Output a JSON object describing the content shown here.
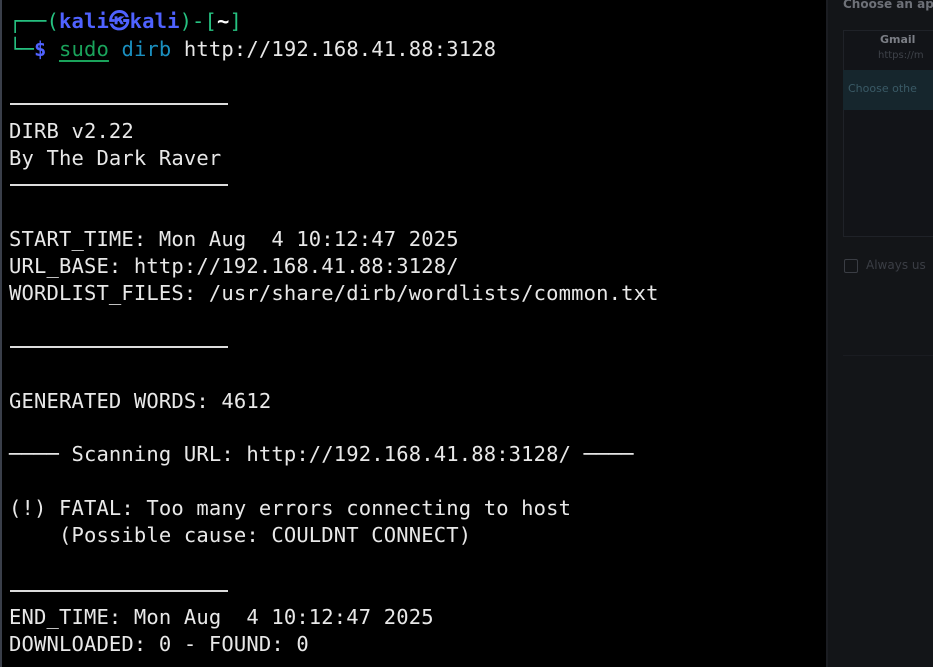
{
  "prompt": {
    "open_frame": "┌──(",
    "user": "kali",
    "at_icon": "㉿",
    "host": "kali",
    "mid_frame": ")-[",
    "cwd": "~",
    "close_frame": "]",
    "corner": "└─",
    "dollar": "$",
    "cmd_sudo": "sudo",
    "cmd_dirb": "dirb",
    "cmd_arg": "http://192.168.41.88:3128"
  },
  "output": {
    "version": "DIRB v2.22",
    "author": "By The Dark Raver",
    "start_time": "START_TIME: Mon Aug  4 10:12:47 2025",
    "url_base": "URL_BASE: http://192.168.41.88:3128/",
    "wordlist": "WORDLIST_FILES: /usr/share/dirb/wordlists/common.txt",
    "generated": "GENERATED WORDS: 4612",
    "scanning": "──── Scanning URL: http://192.168.41.88:3128/ ────",
    "fatal": "(!) FATAL: Too many errors connecting to host",
    "cause": "    (Possible cause: COULDNT CONNECT)",
    "end_time": "END_TIME: Mon Aug  4 10:12:47 2025",
    "downloaded": "DOWNLOADED: 0 - FOUND: 0"
  },
  "background_window": {
    "title": "Choose an ap",
    "gmail": "Gmail",
    "gmail_sub": "https://m",
    "highlight": "Choose othe",
    "always": "Always us"
  },
  "colors": {
    "terminal_bg": "#000000",
    "text": "#e8e8e8",
    "prompt_blue": "#4f62ff",
    "frame_green": "#26c281",
    "sudo_green": "#1aa35b",
    "dirb_cyan": "#1a8fbf"
  }
}
